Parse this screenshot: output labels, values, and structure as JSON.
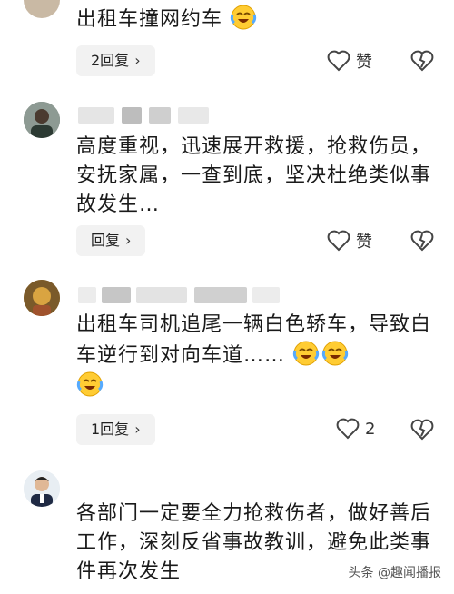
{
  "comments": [
    {
      "text": "出租车撞网约车",
      "emoji_count": 1,
      "reply_label": "2回复",
      "like_label": "赞"
    },
    {
      "text": "高度重视，迅速展开救援，抢救伤员，安抚家属，一查到底，坚决杜绝类似事故发生…",
      "emoji_count": 0,
      "reply_label": "回复",
      "like_label": "赞"
    },
    {
      "text": "出租车司机追尾一辆白色轿车，导致白车逆行到对向车道……",
      "emoji_count": 3,
      "reply_label": "1回复",
      "like_label": "2"
    },
    {
      "text": "各部门一定要全力抢救伤者，做好善后工作，深刻反省事故教训，避免此类事件再次发生",
      "emoji_count": 0
    }
  ],
  "watermark": {
    "label": "头条 @趣闻播报"
  },
  "icons": {
    "emoji": "laughing-crying-emoji-icon",
    "like": "heart-outline-icon",
    "dislike": "broken-heart-icon",
    "chevron": "chevron-right-icon"
  }
}
